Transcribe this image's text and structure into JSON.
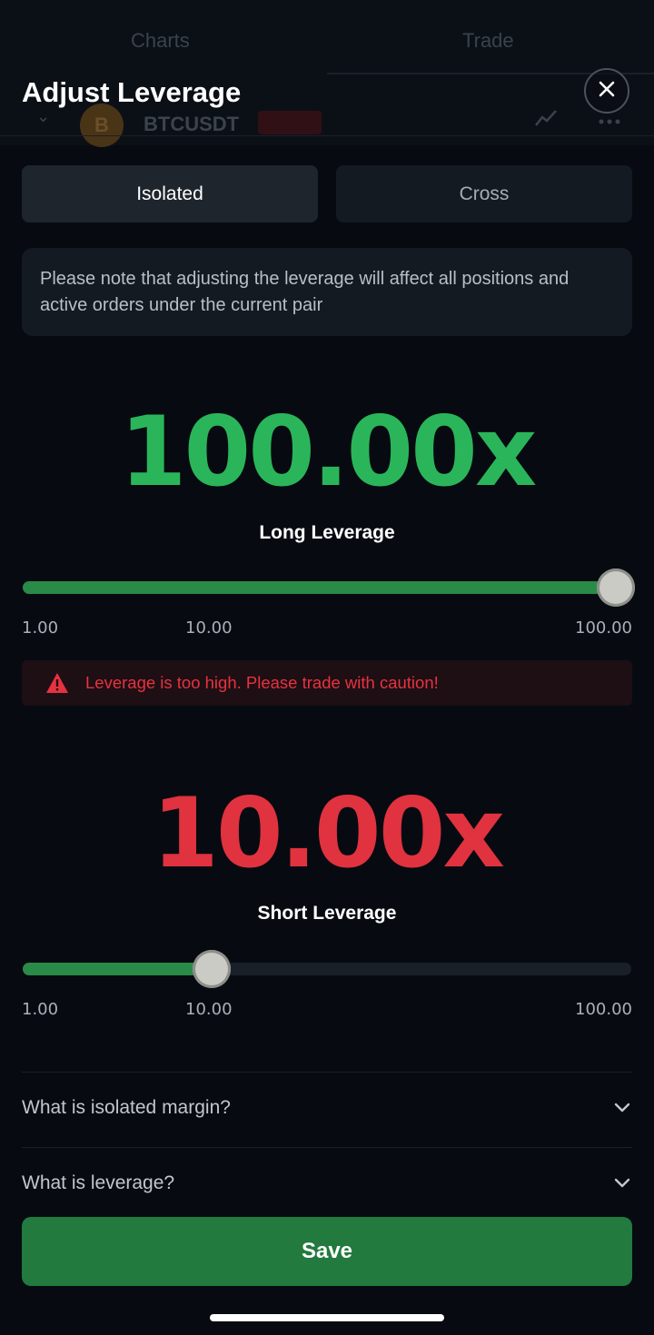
{
  "background": {
    "tabs": [
      "Charts",
      "Trade"
    ],
    "coin_letter": "B",
    "pair_name": "BTCUSDT"
  },
  "modal": {
    "title": "Adjust Leverage"
  },
  "margin_mode": {
    "options": [
      "Isolated",
      "Cross"
    ],
    "selected": "Isolated"
  },
  "notice": "Please note that adjusting the leverage will affect all positions and active orders under the current pair",
  "long": {
    "value_display": "100.00x",
    "label": "Long Leverage",
    "value": 100,
    "slider_fraction": 1.0,
    "ticks": [
      "1.00",
      "10.00",
      "100.00"
    ],
    "color": "#2bb55a"
  },
  "warning": {
    "icon": "warning-triangle-icon",
    "text": "Leverage is too high. Please trade with caution!",
    "color": "#e8323f"
  },
  "short": {
    "value_display": "10.00x",
    "label": "Short Leverage",
    "value": 10,
    "slider_fraction": 0.31,
    "ticks": [
      "1.00",
      "10.00",
      "100.00"
    ],
    "color": "#e0323f"
  },
  "faq": [
    {
      "question": "What is isolated margin?",
      "icon": "chevron-down-icon"
    },
    {
      "question": "What is leverage?",
      "icon": "chevron-down-icon"
    }
  ],
  "save_label": "Save",
  "colors": {
    "accent_green": "#227a3e",
    "slider_fill": "#2a8a48",
    "background": "#070b11"
  }
}
